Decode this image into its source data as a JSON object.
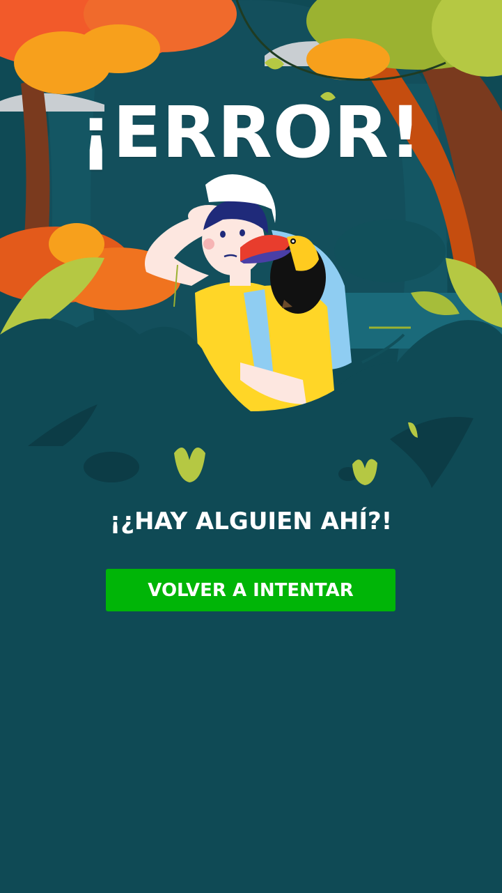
{
  "error_screen": {
    "title": "¡ERROR!",
    "subtitle": "¡¿HAY ALGUIEN AHÍ?!",
    "retry_button_label": "VOLVER A INTENTAR"
  },
  "illustration": {
    "description_icon": "lost-explorer-with-toucan-illustration"
  },
  "colors": {
    "background": "#0f4a55",
    "button": "#00b507",
    "text": "#ffffff"
  }
}
